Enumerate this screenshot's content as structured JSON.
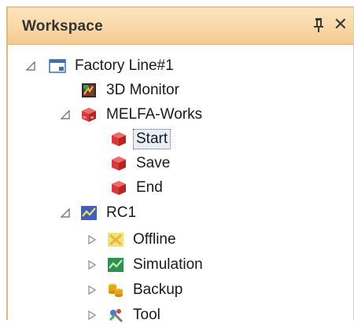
{
  "panel": {
    "title": "Workspace",
    "pin_icon": "pin-icon",
    "close_icon": "close-icon"
  },
  "colors": {
    "title_bar": "#f9d7a8",
    "selection": "#e8eef8"
  },
  "tree": {
    "root": {
      "label": "Factory Line#1",
      "icon": "workspace-window-icon",
      "expanded": true
    },
    "monitor": {
      "label": "3D Monitor",
      "icon": "monitor-3d-icon"
    },
    "melfa": {
      "label": "MELFA-Works",
      "icon": "melfa-cube-icon",
      "expanded": true
    },
    "start": {
      "label": "Start",
      "icon": "melfa-cube-icon",
      "selected": true
    },
    "save": {
      "label": "Save",
      "icon": "melfa-cube-icon"
    },
    "end": {
      "label": "End",
      "icon": "melfa-cube-icon"
    },
    "rc1": {
      "label": "RC1",
      "icon": "robot-controller-icon",
      "expanded": true
    },
    "offline": {
      "label": "Offline",
      "icon": "offline-icon",
      "expanded": false
    },
    "simulation": {
      "label": "Simulation",
      "icon": "simulation-icon",
      "expanded": false
    },
    "backup": {
      "label": "Backup",
      "icon": "backup-icon",
      "expanded": false
    },
    "tool": {
      "label": "Tool",
      "icon": "tool-icon",
      "expanded": false
    }
  }
}
